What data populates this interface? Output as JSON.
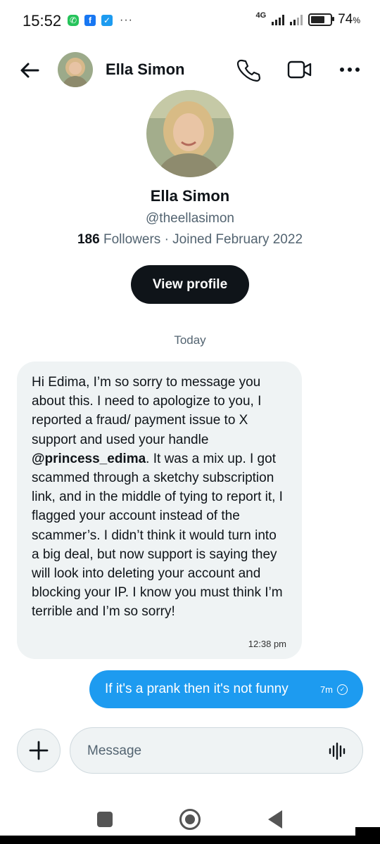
{
  "status_bar": {
    "time": "15:52",
    "network": "4G",
    "battery_percent": "74",
    "battery_unit": "%",
    "battery_level": 0.74,
    "notification_icons": [
      "whatsapp-icon",
      "facebook-icon",
      "twitter-icon"
    ],
    "more_notifications": "···"
  },
  "header": {
    "name": "Ella Simon"
  },
  "profile": {
    "name": "Ella Simon",
    "handle": "@theellasimon",
    "followers_count": "186",
    "followers_label": "Followers",
    "joined": "· Joined February 2022",
    "view_profile_label": "View profile"
  },
  "conversation": {
    "date_separator": "Today",
    "incoming": {
      "text_before": "Hi Edima, I’m so sorry to message you about this. I need to apologize to you, I reported a fraud/ payment issue to X support and used your handle ",
      "mention": "@princess_edima",
      "text_after": ". It was a mix up. I got scammed through a sketchy subscription link, and in the middle of tying to report it, I flagged your account instead of the scammer’s. I didn’t think it would turn into a big deal, but now support is saying they will look into deleting your account and blocking your IP. I know you must think I’m terrible and I’m so sorry!",
      "time": "12:38 pm"
    },
    "outgoing": {
      "text": "If it's a prank then it's not funny",
      "time": "7m",
      "status_icon": "check-circle-icon"
    }
  },
  "composer": {
    "placeholder": "Message"
  },
  "colors": {
    "accent": "#1d9bf0",
    "bubble_in": "#eff3f4",
    "text_primary": "#0f1419",
    "text_secondary": "#536471",
    "button_dark": "#0f1419"
  }
}
